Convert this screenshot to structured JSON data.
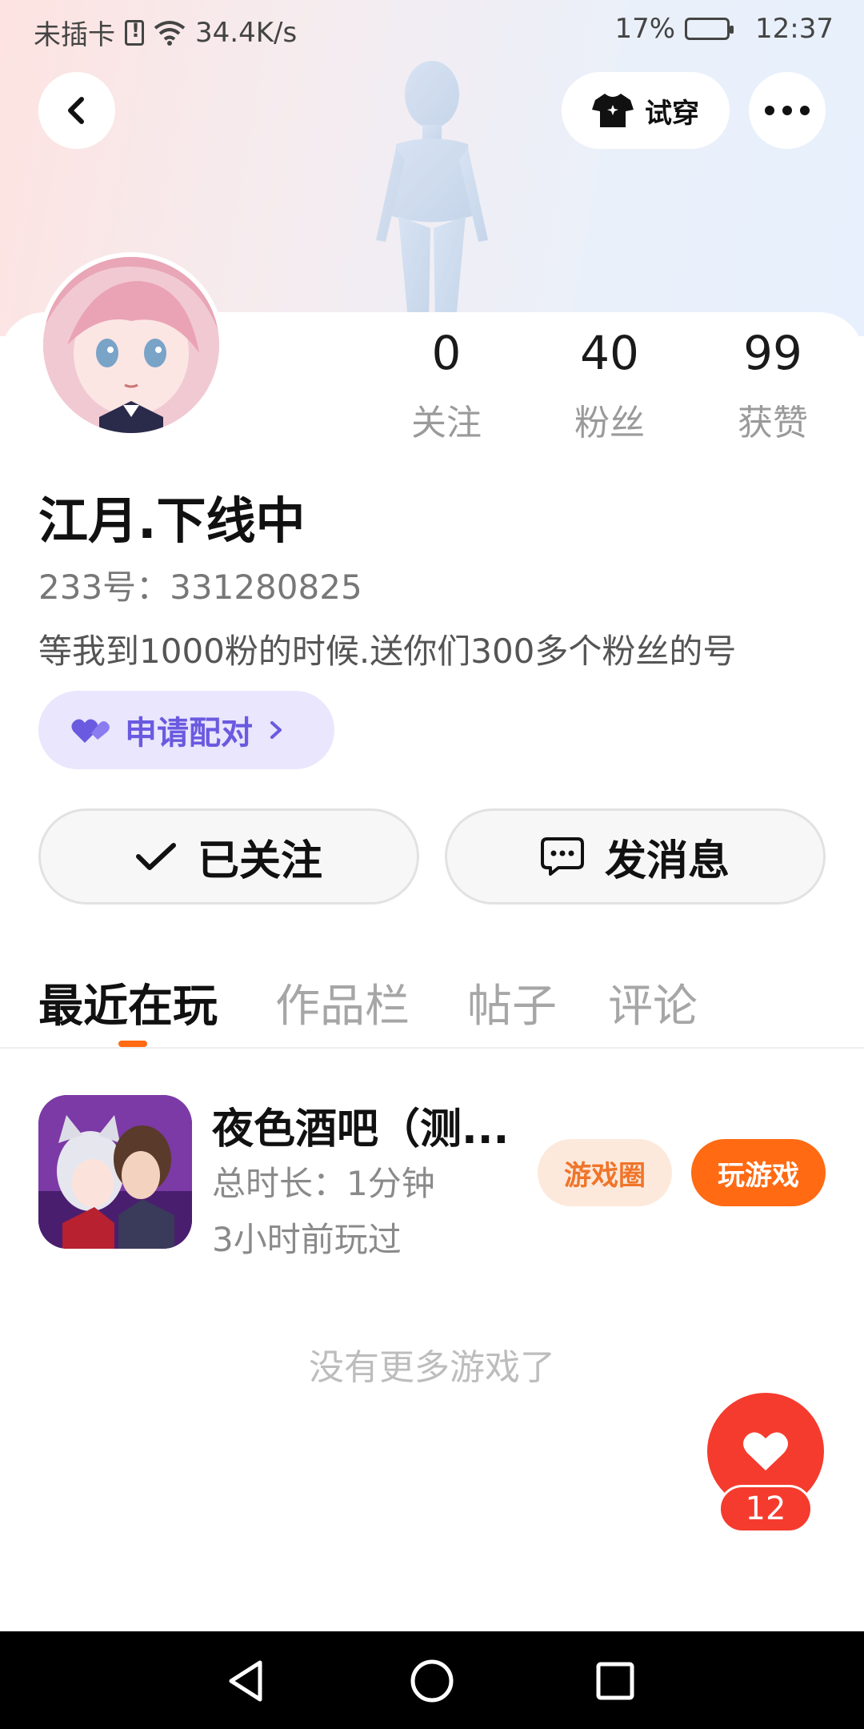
{
  "status_bar": {
    "carrier": "未插卡",
    "net_speed": "34.4K/s",
    "battery_percent": "17%",
    "battery_level": 0.17,
    "time": "12:37"
  },
  "header": {
    "back_icon": "chevron-left-icon",
    "tryon_label": "试穿",
    "more_icon": "more-dots-icon"
  },
  "profile": {
    "stats": [
      {
        "value": "0",
        "label": "关注"
      },
      {
        "value": "40",
        "label": "粉丝"
      },
      {
        "value": "99",
        "label": "获赞"
      }
    ],
    "username": "江月.下线中",
    "uid": "233号：331280825",
    "bio": "等我到1000粉的时候.送你们300多个粉丝的号",
    "pair_label": "申请配对",
    "follow_label": "已关注",
    "message_label": "发消息"
  },
  "tabs": [
    {
      "label": "最近在玩",
      "active": true
    },
    {
      "label": "作品栏",
      "active": false
    },
    {
      "label": "帖子",
      "active": false
    },
    {
      "label": "评论",
      "active": false
    }
  ],
  "games": [
    {
      "title": "夜色酒吧（测...",
      "duration": "总时长：1分钟",
      "last_played": "3小时前玩过",
      "circle_label": "游戏圈",
      "play_label": "玩游戏"
    }
  ],
  "no_more_text": "没有更多游戏了",
  "like": {
    "count": "12"
  },
  "colors": {
    "accent_orange": "#ff6a13",
    "pair_purple": "#6a5ae0",
    "like_red": "#f53b2e"
  }
}
